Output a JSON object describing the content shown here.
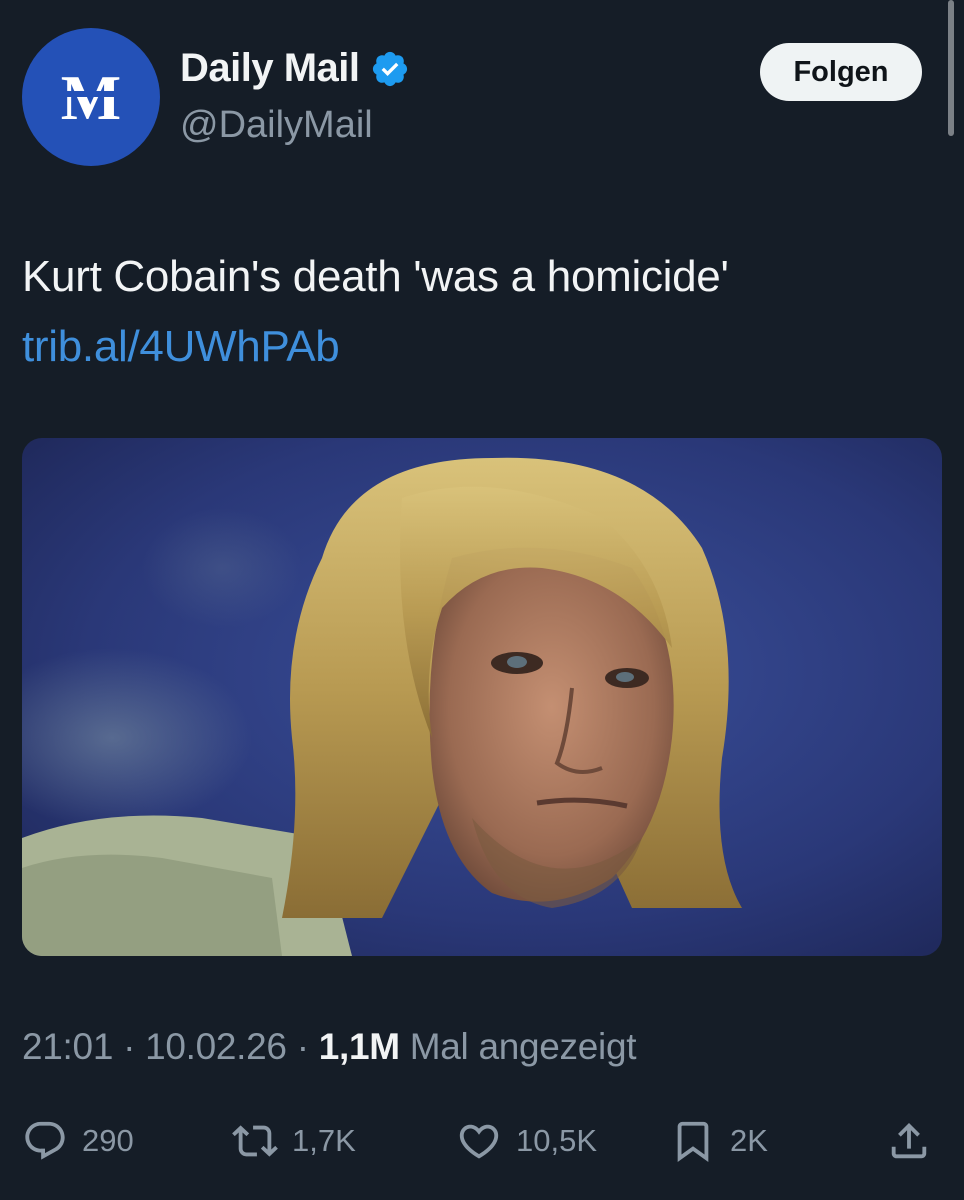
{
  "account": {
    "name": "Daily Mail",
    "handle": "@DailyMail",
    "avatar_icon": "daily-mail-logo",
    "verified_icon": "verified-badge-icon",
    "brand_color": "#2451b7",
    "verified_color": "#1d9bf0"
  },
  "follow_button": {
    "label": "Folgen"
  },
  "tweet": {
    "text": "Kurt Cobain's death 'was a homicide'",
    "link": "trib.al/4UWhPAb",
    "link_color": "#3f8fdc"
  },
  "meta": {
    "time": "21:01",
    "sep1": " · ",
    "date": "10.02.26",
    "sep2": " · ",
    "views": "1,1M",
    "views_suffix": " Mal angezeigt"
  },
  "actions": {
    "reply": {
      "icon": "reply-icon",
      "count": "290"
    },
    "repost": {
      "icon": "repost-icon",
      "count": "1,7K"
    },
    "like": {
      "icon": "heart-icon",
      "count": "10,5K"
    },
    "bookmark": {
      "icon": "bookmark-icon",
      "count": "2K"
    },
    "share": {
      "icon": "share-icon"
    }
  }
}
